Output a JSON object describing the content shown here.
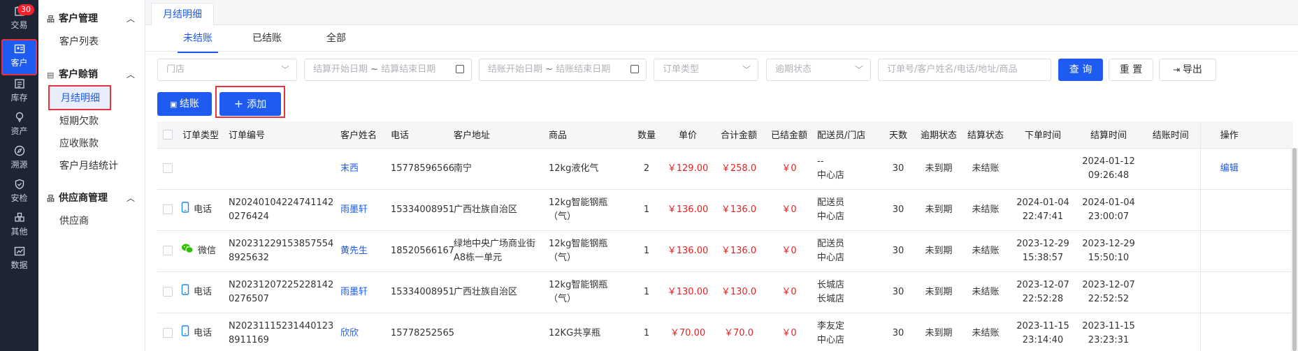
{
  "rail": {
    "items": [
      {
        "label": "交易",
        "icon": "trade-icon",
        "badge": "30"
      },
      {
        "label": "客户",
        "icon": "customer-icon"
      },
      {
        "label": "库存",
        "icon": "inventory-icon"
      },
      {
        "label": "资产",
        "icon": "asset-icon"
      },
      {
        "label": "溯源",
        "icon": "trace-icon"
      },
      {
        "label": "安检",
        "icon": "safety-icon"
      },
      {
        "label": "其他",
        "icon": "other-icon"
      },
      {
        "label": "数据",
        "icon": "data-icon"
      }
    ]
  },
  "sidebar": {
    "groups": [
      {
        "title": "客户管理",
        "items": [
          "客户列表"
        ]
      },
      {
        "title": "客户赊销",
        "items": [
          "月结明细",
          "短期欠款",
          "应收账款",
          "客户月结统计"
        ]
      },
      {
        "title": "供应商管理",
        "items": [
          "供应商"
        ]
      }
    ]
  },
  "page_tab": "月结明细",
  "subtabs": [
    "未结账",
    "已结账",
    "全部"
  ],
  "filters": {
    "store": "门店",
    "settle_start": "结算开始日期",
    "settle_sep": "~",
    "settle_end": "结算结束日期",
    "checkout_start": "结账开始日期",
    "checkout_sep": "~",
    "checkout_end": "结账结束日期",
    "order_type": "订单类型",
    "overdue": "逾期状态",
    "search_placeholder": "订单号/客户姓名/电话/地址/商品"
  },
  "buttons": {
    "query": "查 询",
    "reset": "重 置",
    "export": "导出",
    "settle": "结账",
    "add": "添加"
  },
  "table": {
    "headers": [
      "订单类型",
      "订单编号",
      "客户姓名",
      "电话",
      "客户地址",
      "商品",
      "数量",
      "单价",
      "合计金额",
      "已结金额",
      "配送员/门店",
      "天数",
      "逾期状态",
      "结算状态",
      "下单时间",
      "结算时间",
      "结账时间",
      "操作"
    ],
    "rows": [
      {
        "type": "",
        "type_icon": "",
        "order_no": "",
        "customer": "末西",
        "phone": "15778596566",
        "address": "南宁",
        "goods": "12kg液化气",
        "qty": "2",
        "price": "￥129.00",
        "total": "￥258.0",
        "paid": "￥0",
        "courier": "--",
        "store": "中心店",
        "days": "30",
        "overdue": "未到期",
        "status": "未结账",
        "order_date": "",
        "order_time": "",
        "settle_date": "2024-01-12",
        "settle_time": "09:26:48",
        "checkout": "",
        "op": "编辑"
      },
      {
        "type": "电话",
        "type_icon": "phone-icon",
        "order_no": "N202401042247411420276424",
        "customer": "雨墨轩",
        "phone": "15334008951",
        "address": "广西壮族自治区",
        "goods": "12kg智能钢瓶（气）",
        "qty": "1",
        "price": "￥136.00",
        "total": "￥136.0",
        "paid": "￥0",
        "courier": "配送员",
        "store": "中心店",
        "days": "30",
        "overdue": "未到期",
        "status": "未结账",
        "order_date": "2024-01-04",
        "order_time": "22:47:41",
        "settle_date": "2024-01-04",
        "settle_time": "23:00:07",
        "checkout": "",
        "op": ""
      },
      {
        "type": "微信",
        "type_icon": "wechat-icon",
        "order_no": "N202312291538575548925632",
        "customer": "黄先生",
        "phone": "18520566167",
        "address": "绿地中央广场商业街A8栋一单元",
        "goods": "12kg智能钢瓶（气）",
        "qty": "1",
        "price": "￥136.00",
        "total": "￥136.0",
        "paid": "￥0",
        "courier": "配送员",
        "store": "中心店",
        "days": "30",
        "overdue": "未到期",
        "status": "未结账",
        "order_date": "2023-12-29",
        "order_time": "15:38:57",
        "settle_date": "2023-12-29",
        "settle_time": "15:50:10",
        "checkout": "",
        "op": ""
      },
      {
        "type": "电话",
        "type_icon": "phone-icon",
        "order_no": "N202312072252281420276507",
        "customer": "雨墨轩",
        "phone": "15334008951",
        "address": "广西壮族自治区",
        "goods": "12kg智能钢瓶（气）",
        "qty": "1",
        "price": "￥130.00",
        "total": "￥130.0",
        "paid": "￥0",
        "courier": "长城店",
        "store": "长城店",
        "days": "30",
        "overdue": "未到期",
        "status": "未结账",
        "order_date": "2023-12-07",
        "order_time": "22:52:28",
        "settle_date": "2023-12-07",
        "settle_time": "22:52:52",
        "checkout": "",
        "op": ""
      },
      {
        "type": "电话",
        "type_icon": "phone-icon",
        "order_no": "N202311152314401238911169",
        "customer": "欣欣",
        "phone": "15778252565",
        "address": "",
        "goods": "12KG共享瓶",
        "qty": "1",
        "price": "￥70.00",
        "total": "￥70.0",
        "paid": "￥0",
        "courier": "李友定",
        "store": "中心店",
        "days": "30",
        "overdue": "未到期",
        "status": "未结账",
        "order_date": "2023-11-15",
        "order_time": "23:14:40",
        "settle_date": "2023-11-15",
        "settle_time": "23:23:31",
        "checkout": "",
        "op": ""
      }
    ]
  }
}
